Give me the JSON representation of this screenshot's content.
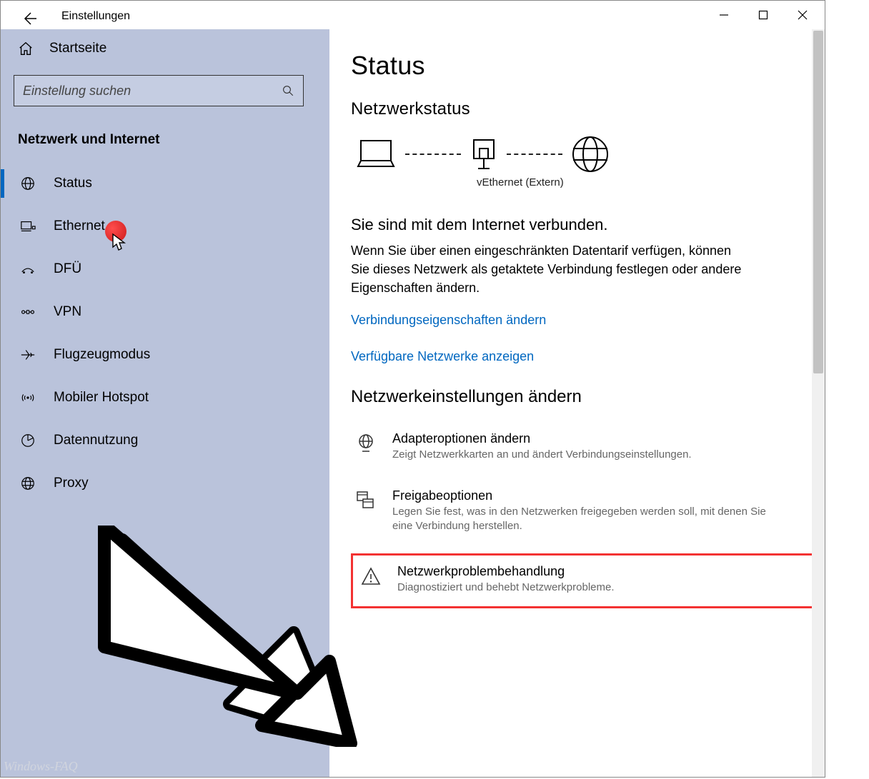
{
  "window": {
    "title": "Einstellungen"
  },
  "sidebar": {
    "home": "Startseite",
    "search_placeholder": "Einstellung suchen",
    "section": "Netzwerk und Internet",
    "items": [
      {
        "label": "Status",
        "icon": "globe-grid-icon",
        "active": true
      },
      {
        "label": "Ethernet",
        "icon": "ethernet-icon",
        "active": false
      },
      {
        "label": "DFÜ",
        "icon": "dialup-icon",
        "active": false
      },
      {
        "label": "VPN",
        "icon": "vpn-icon",
        "active": false
      },
      {
        "label": "Flugzeugmodus",
        "icon": "airplane-icon",
        "active": false
      },
      {
        "label": "Mobiler Hotspot",
        "icon": "hotspot-icon",
        "active": false
      },
      {
        "label": "Datennutzung",
        "icon": "datausage-icon",
        "active": false
      },
      {
        "label": "Proxy",
        "icon": "proxy-icon",
        "active": false
      }
    ]
  },
  "main": {
    "page_title": "Status",
    "status_heading": "Netzwerkstatus",
    "adapter_label": "vEthernet (Extern)",
    "connected_heading": "Sie sind mit dem Internet verbunden.",
    "connected_description": "Wenn Sie über einen eingeschränkten Datentarif verfügen, können Sie dieses Netzwerk als getaktete Verbindung festlegen oder andere Eigenschaften ändern.",
    "link_properties": "Verbindungseigenschaften ändern",
    "link_networks": "Verfügbare Netzwerke anzeigen",
    "change_heading": "Netzwerkeinstellungen ändern",
    "options": [
      {
        "title": "Adapteroptionen ändern",
        "desc": "Zeigt Netzwerkkarten an und ändert Verbindungseinstellungen."
      },
      {
        "title": "Freigabeoptionen",
        "desc": "Legen Sie fest, was in den Netzwerken freigegeben werden soll, mit denen Sie eine Verbindung herstellen."
      },
      {
        "title": "Netzwerkproblembehandlung",
        "desc": "Diagnostiziert und behebt Netzwerkprobleme."
      }
    ]
  },
  "watermark": "Windows-FAQ"
}
